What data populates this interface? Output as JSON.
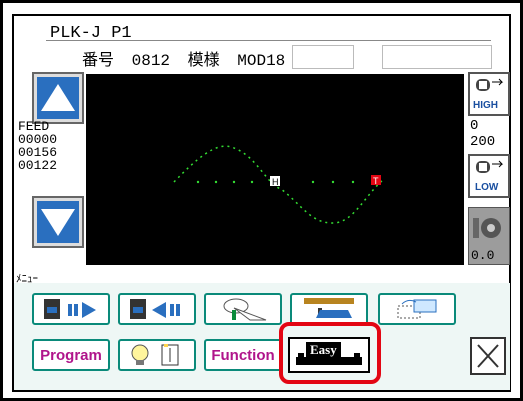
{
  "header": {
    "title": "PLK-J P1",
    "number_label": "番号",
    "number_value": "0812",
    "pattern_label": "模様",
    "pattern_value": "MOD18"
  },
  "left_panel": {
    "feed_label": "FEED",
    "feed_values": [
      "00000",
      "00156",
      "00122"
    ]
  },
  "right_panel": {
    "high_label": "HIGH",
    "low_label": "LOW",
    "value_top": "0",
    "value_bottom": "200",
    "gauge_value": "0.0"
  },
  "screen": {
    "start_marker": "H",
    "end_marker": "T"
  },
  "menu": {
    "label": "ﾒﾆｭｰ",
    "program_label": "Program",
    "function_label": "Function",
    "easy_label": "Easy"
  },
  "colors": {
    "accent_teal": "#0a8a7a",
    "program_text": "#b0148b",
    "highlight_red": "#e30613",
    "arrow_blue": "#2a6fbf",
    "stitch_green": "#33dd33"
  },
  "icons": {
    "up": "up-arrow-icon",
    "down": "down-arrow-icon",
    "high": "speed-high-icon",
    "low": "speed-low-icon",
    "bobbin": "bobbin-icon",
    "feed_forward": "feed-forward-icon",
    "feed_backward": "feed-backward-icon",
    "edit": "edit-shape-icon",
    "measure": "measure-icon",
    "copy": "copy-icon",
    "bulb": "bulb-icon",
    "clip": "clip-icon",
    "close": "close-icon"
  }
}
